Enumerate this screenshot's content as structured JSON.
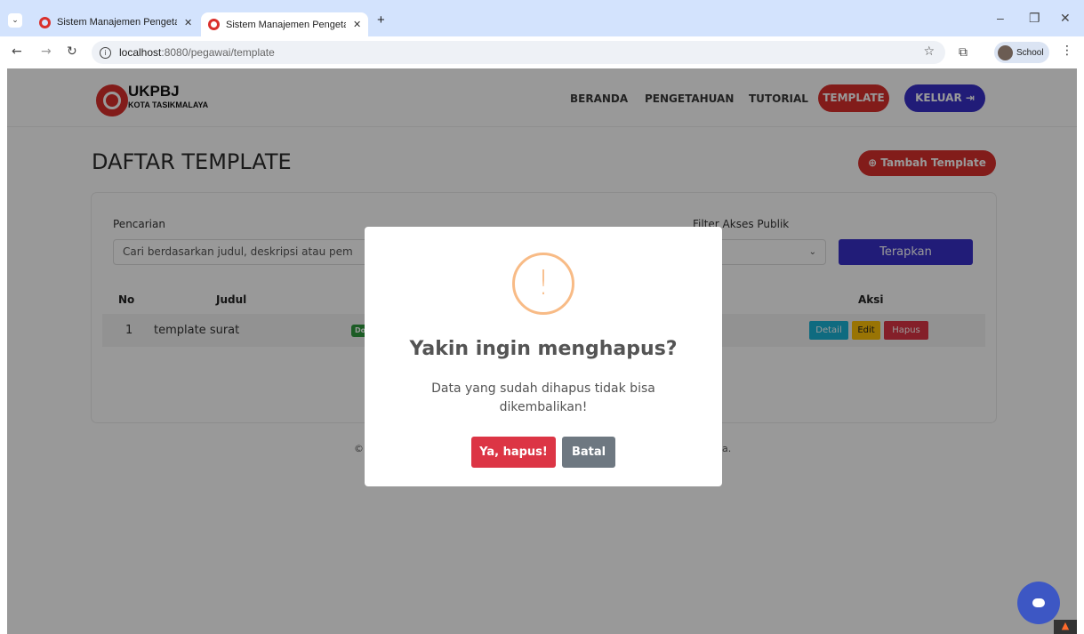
{
  "browser": {
    "tabs": [
      {
        "title": "Sistem Manajemen Pengetahuan"
      },
      {
        "title": "Sistem Manajemen Pengetahuan"
      }
    ],
    "new_tab": "+",
    "url_host": "localhost",
    "url_path": ":8080/pegawai/template",
    "profile_label": "School"
  },
  "navbar": {
    "logo_main": "UKPBJ",
    "logo_sub": "KOTA TASIKMALAYA",
    "links": [
      "BERANDA",
      "PENGETAHUAN",
      "TUTORIAL"
    ],
    "template_label": "TEMPLATE",
    "logout_label": "KELUAR ⇥"
  },
  "page": {
    "title": "DAFTAR TEMPLATE",
    "add_button": "⊕ Tambah Template",
    "search_label": "Pencarian",
    "search_placeholder": "Cari berdasarkan judul, deskripsi atau pem",
    "filter_label": "Filter Akses Publik",
    "filter_value": "nua",
    "apply_button": "Terapkan",
    "columns": {
      "no": "No",
      "judul": "Judul",
      "aksi": "Aksi"
    },
    "rows": [
      {
        "no": "1",
        "judul": "template surat",
        "badge": "Do"
      }
    ],
    "actions": {
      "detail": "Detail",
      "edit": "Edit",
      "hapus": "Hapus"
    },
    "footer_left": "©",
    "footer_right": "a."
  },
  "modal": {
    "icon": "!",
    "title": "Yakin ingin menghapus?",
    "text": "Data yang sudah dihapus tidak bisa dikembalikan!",
    "confirm": "Ya, hapus!",
    "cancel": "Batal"
  },
  "colors": {
    "brand_red": "#d9302c",
    "brand_blue": "#3730c9",
    "warning_orange": "#f8bb86"
  }
}
